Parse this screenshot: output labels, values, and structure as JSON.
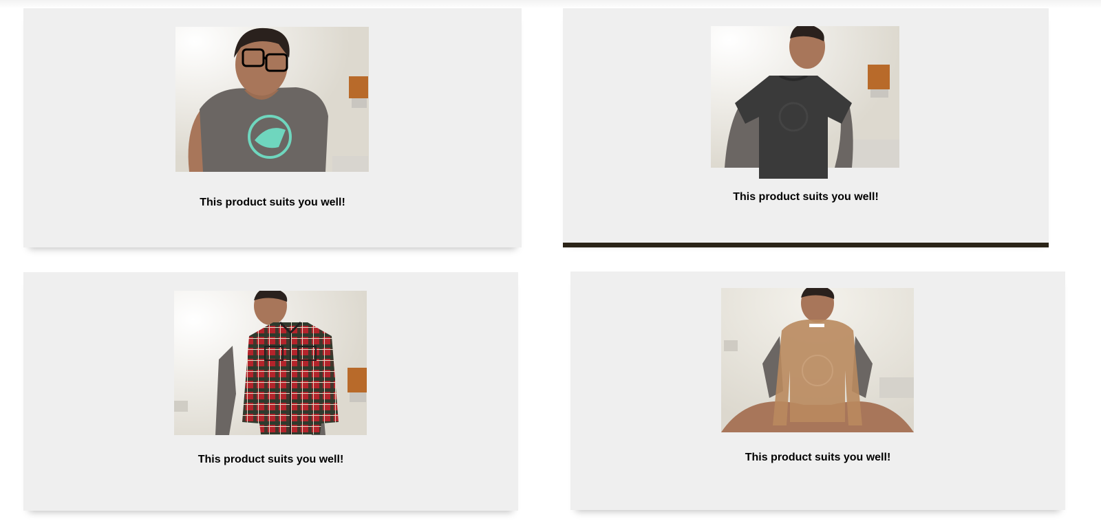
{
  "panels": [
    {
      "id": "glasses",
      "product_icon": "glasses-overlay-icon",
      "caption": "This product suits you well!"
    },
    {
      "id": "tshirt",
      "product_icon": "tshirt-overlay-icon",
      "caption": "This product suits you well!"
    },
    {
      "id": "plaid-shirt",
      "product_icon": "plaid-shirt-overlay-icon",
      "caption": "This product suits you well!"
    },
    {
      "id": "sweater",
      "product_icon": "sweater-overlay-icon",
      "caption": "This product suits you well!"
    }
  ],
  "colors": {
    "panel_background": "#efefef",
    "caption_text": "#000000",
    "room_wall": "#e6e4dc",
    "skin": "#a8765a",
    "hair": "#2a211d",
    "tee_grey": "#6b6663",
    "tee_logo": "#6fd6be",
    "tshirt_black": "#3a3a3a",
    "plaid_red": "#b3242b",
    "plaid_dark": "#2f3a2d",
    "sweater_tan": "#b98a5e"
  }
}
